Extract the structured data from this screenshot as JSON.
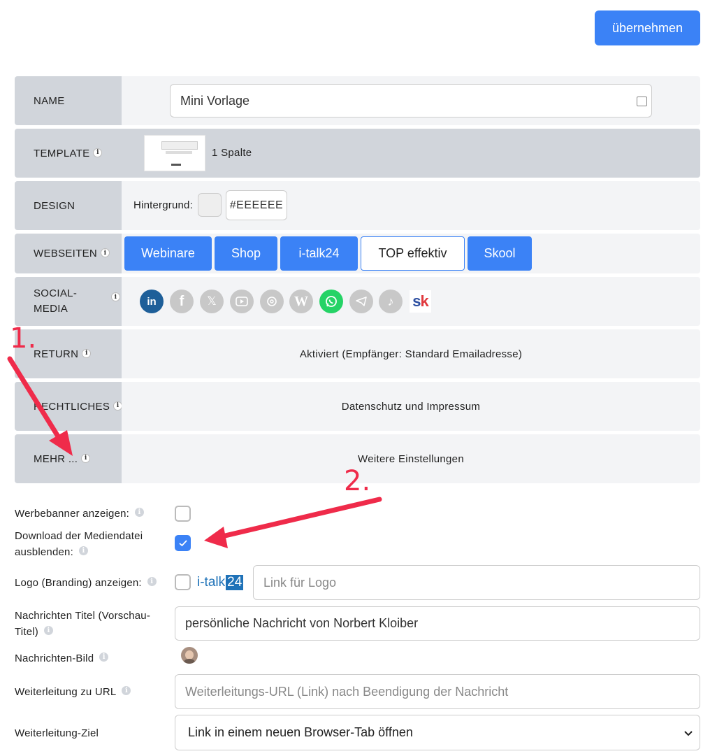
{
  "apply_button": "übernehmen",
  "rows": {
    "name": {
      "label": "NAME",
      "value": "Mini Vorlage"
    },
    "template": {
      "label": "TEMPLATE",
      "value": "1 Spalte"
    },
    "design": {
      "label": "DESIGN",
      "bg_label": "Hintergrund:",
      "bg_value": "#EEEEEE"
    },
    "webseiten": {
      "label": "WEBSEITEN",
      "sites": [
        "Webinare",
        "Shop",
        "i-talk24",
        "TOP effektiv",
        "Skool"
      ]
    },
    "social": {
      "label": "SOCIAL-\nMEDIA",
      "icons": [
        "linkedin-icon",
        "facebook-icon",
        "x-icon",
        "youtube-icon",
        "threads-icon",
        "wordpress-icon",
        "whatsapp-icon",
        "telegram-icon",
        "tiktok-icon",
        "skool-icon"
      ]
    },
    "return": {
      "label": "RETURN",
      "value": "Aktiviert (Empfänger: Standard Emailadresse)"
    },
    "rechtliches": {
      "label": "RECHTLICHES",
      "value": "Datenschutz und Impressum"
    },
    "mehr": {
      "label": "MEHR ...",
      "value": "Weitere Einstellungen"
    }
  },
  "form": {
    "werbebanner": {
      "label": "Werbebanner anzeigen:",
      "checked": false
    },
    "download": {
      "label_line1": "Download der Mediendatei",
      "label_line2": "ausblenden:",
      "checked": true
    },
    "logo": {
      "label": "Logo (Branding) anzeigen:",
      "brand_text": "i-talk",
      "brand_num": "24",
      "placeholder": "Link für Logo",
      "checked": false
    },
    "nachrichten_titel": {
      "label_line1": "Nachrichten Titel (Vorschau-",
      "label_line2": "Titel)",
      "value": "persönliche Nachricht von Norbert Kloiber"
    },
    "nachrichten_bild": {
      "label": "Nachrichten-Bild"
    },
    "weiterleitung_url": {
      "label": "Weiterleitung zu URL",
      "placeholder": "Weiterleitungs-URL (Link) nach Beendigung der Nachricht"
    },
    "weiterleitung_ziel": {
      "label": "Weiterleitung-Ziel",
      "value": "Link in einem neuen Browser-Tab öffnen"
    }
  },
  "annotations": {
    "step1": "1.",
    "step2": "2."
  },
  "colors": {
    "accent": "#3b82f6",
    "annotation": "#ef2b4a",
    "row_label_bg": "#d1d5db",
    "row_body_bg": "#f3f4f6"
  }
}
